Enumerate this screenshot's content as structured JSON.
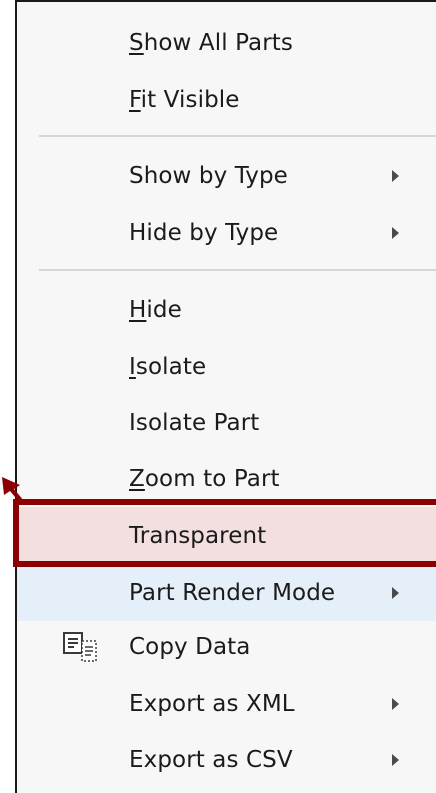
{
  "menu": {
    "items": [
      {
        "label": "Show All Parts",
        "accel_index": 0,
        "submenu": false
      },
      {
        "label": "Fit Visible",
        "accel_index": 0,
        "submenu": false
      },
      {
        "label": "Show by Type",
        "accel_index": -1,
        "submenu": true
      },
      {
        "label": "Hide by Type",
        "accel_index": -1,
        "submenu": true
      },
      {
        "label": "Hide",
        "accel_index": 0,
        "submenu": false
      },
      {
        "label": "Isolate",
        "accel_index": 0,
        "submenu": false
      },
      {
        "label": "Isolate Part",
        "accel_index": -1,
        "submenu": false
      },
      {
        "label": "Zoom to Part",
        "accel_index": 0,
        "submenu": false
      },
      {
        "label": "Transparent",
        "accel_index": -1,
        "submenu": false,
        "highlighted": true
      },
      {
        "label": "Part Render Mode",
        "accel_index": -1,
        "submenu": true,
        "hovered": true
      },
      {
        "label": "Copy Data",
        "accel_index": -1,
        "submenu": false,
        "icon": "copy-data-icon"
      },
      {
        "label": "Export as XML",
        "accel_index": -1,
        "submenu": true
      },
      {
        "label": "Export as CSV",
        "accel_index": -1,
        "submenu": true
      }
    ]
  },
  "colors": {
    "highlight_border": "#8b0000",
    "highlight_fill": "#f3dfdf",
    "hover_fill": "#e5effa",
    "menu_bg": "#f7f7f7"
  }
}
